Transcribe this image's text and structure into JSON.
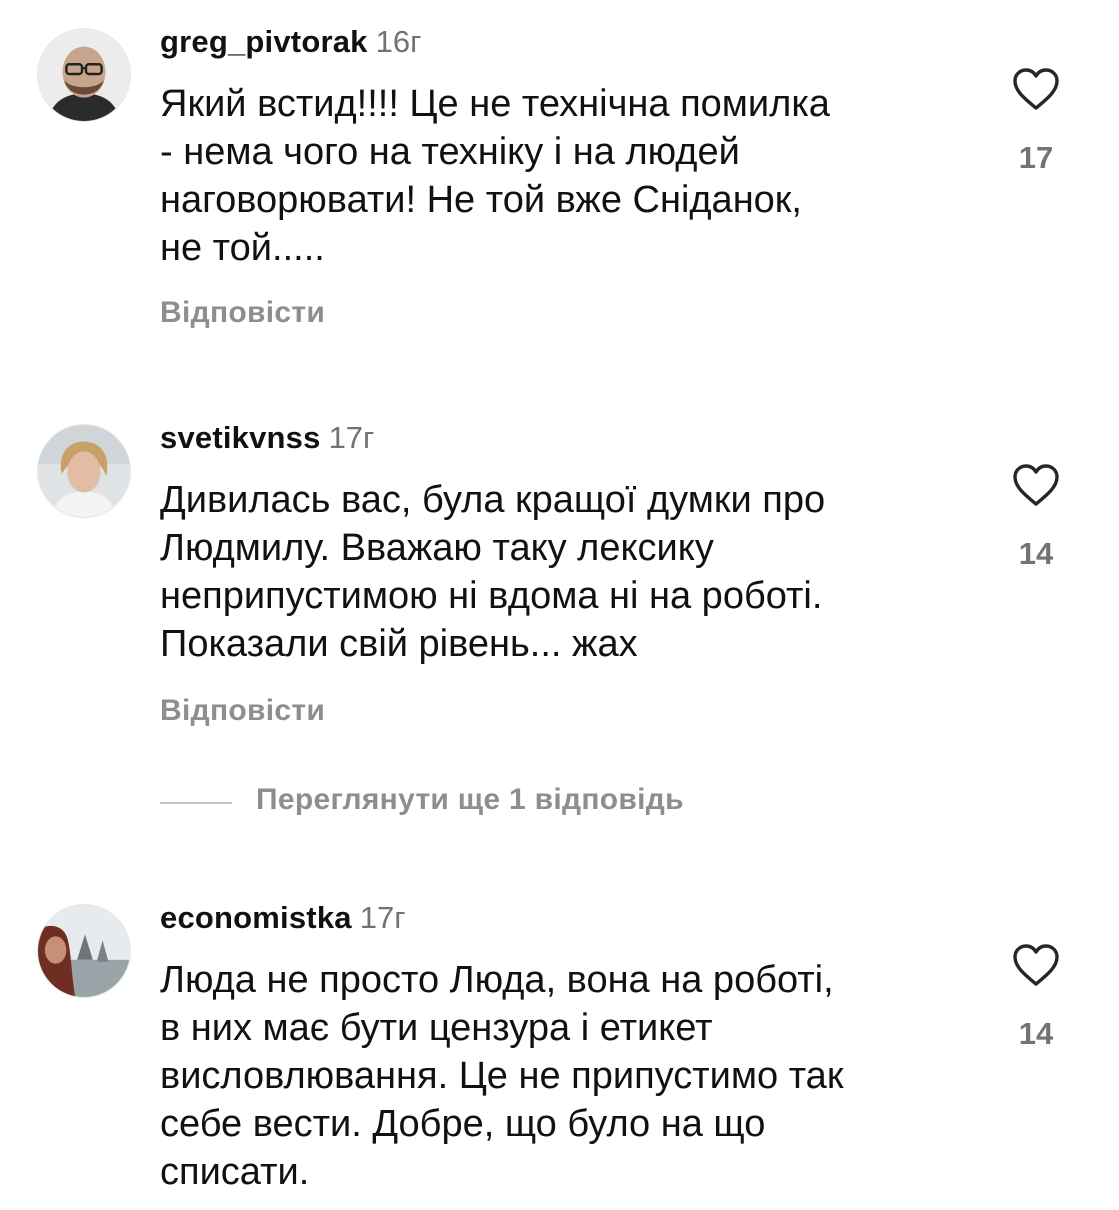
{
  "comments": [
    {
      "username": "greg_pivtorak",
      "time": "16г",
      "text": "Який встид!!!! Це не технічна помилка\n- нема чого на техніку і на людей\nнаговорювати!  Не той вже Сніданок,\nне той.....",
      "reply_label": "Відповісти",
      "likes": "17",
      "like_icon": "heart-outline-icon"
    },
    {
      "username": "svetikvnss",
      "time": "17г",
      "text": "Дивилась вас, була кращої думки про\nЛюдмилу. Вважаю таку лексику\nнеприпустимою ні вдома ні на роботі.\nПоказали свій рівень... жах",
      "reply_label": "Відповісти",
      "likes": "14",
      "like_icon": "heart-outline-icon",
      "view_replies": "Переглянути ще 1 відповідь"
    },
    {
      "username": "economistka",
      "time": "17г",
      "text": "Люда не просто Люда, вона на роботі,\nв них має бути цензура і етикет\nвисловлювання. Це не припустимо так\nсебе вести. Добре, що було на що\nсписати.",
      "likes": "14",
      "like_icon": "heart-outline-icon"
    }
  ]
}
